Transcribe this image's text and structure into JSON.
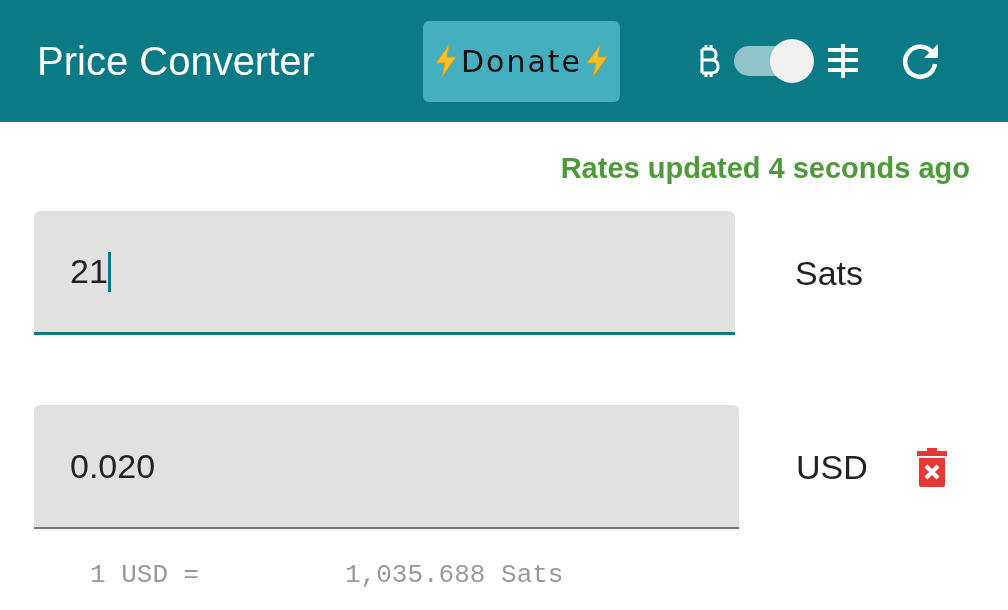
{
  "app_bar": {
    "title": "Price Converter",
    "donate_label": "Donate",
    "unit_toggle": {
      "on": true
    }
  },
  "status": "Rates updated 4 seconds ago",
  "rows": [
    {
      "value": "21",
      "unit": "Sats",
      "focused": true,
      "removable": false
    },
    {
      "value": "0.020",
      "unit": "USD",
      "focused": false,
      "removable": true
    }
  ],
  "rate": {
    "left": "1 USD =",
    "right": "1,035.688 Sats"
  }
}
